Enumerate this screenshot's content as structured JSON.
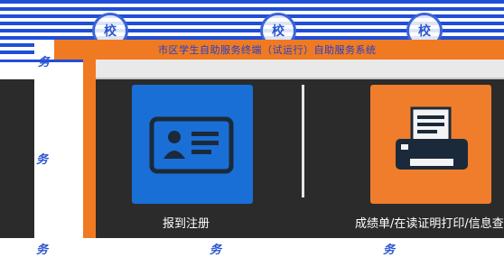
{
  "header": {
    "title": "市区学生自助服务终端（试运行）自助服务系统",
    "emblem_text": "校"
  },
  "tiles": {
    "register": {
      "label": "报到注册",
      "icon": "id-card-icon",
      "color": "#1a6fd6"
    },
    "print": {
      "label": "成绩单/在读证明打印/信息查询",
      "icon": "printer-icon",
      "color": "#ef7d2c"
    }
  },
  "watermark_text": "务",
  "colors": {
    "accent_orange": "#f07a22",
    "accent_blue": "#1f4fd8",
    "panel": "#2b2b2b"
  }
}
